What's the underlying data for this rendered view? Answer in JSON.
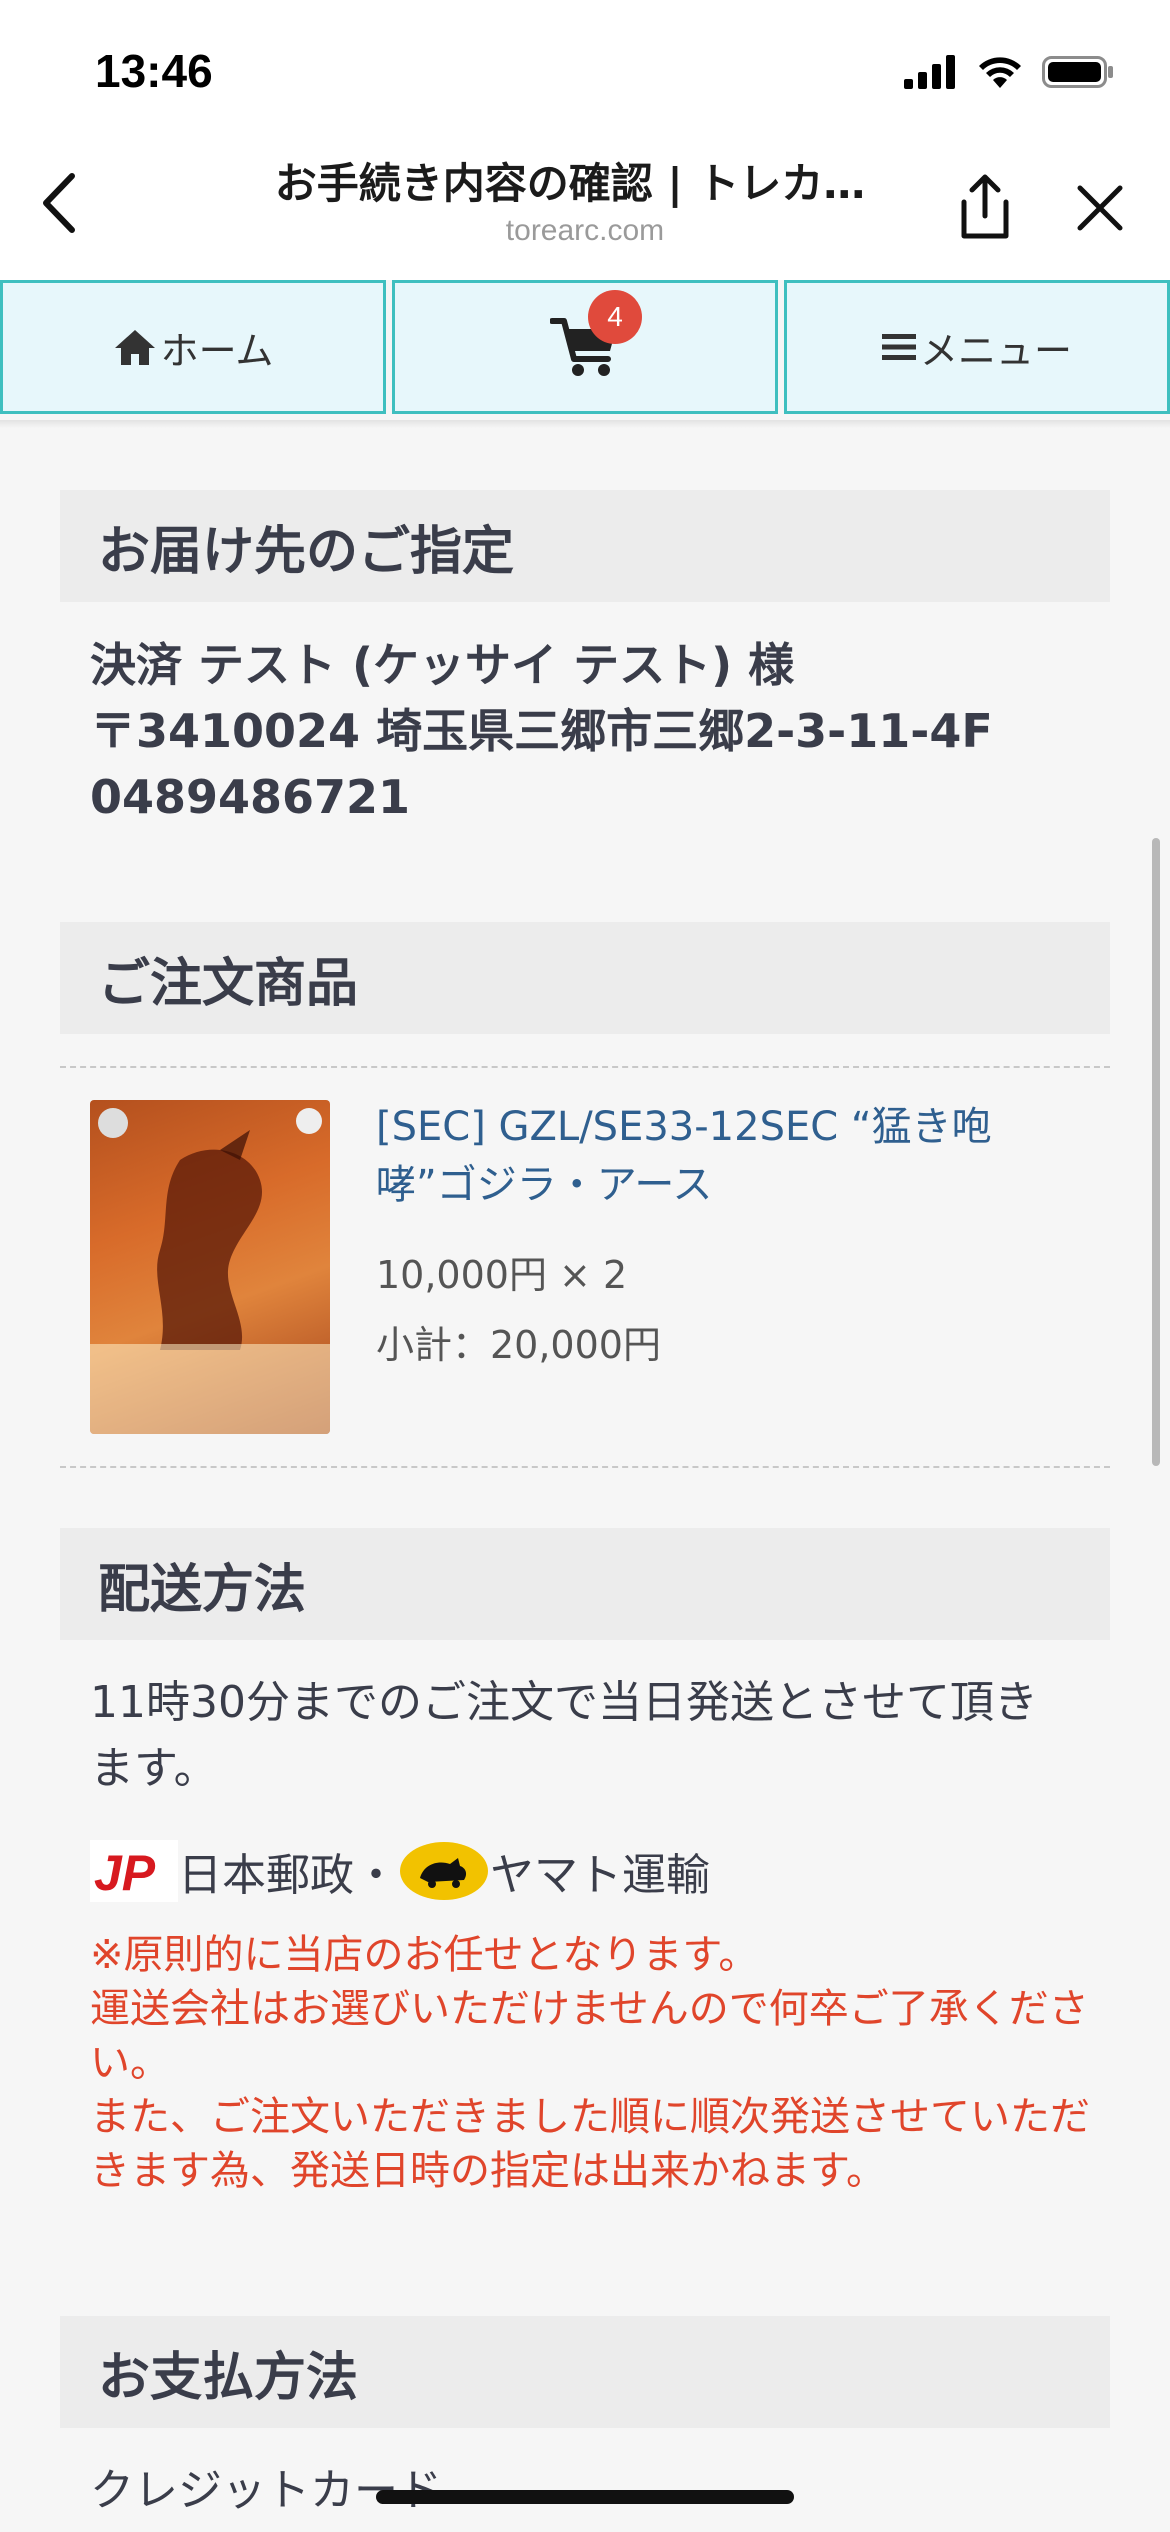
{
  "status_bar": {
    "time": "13:46"
  },
  "browser": {
    "title": "お手続き内容の確認 | トレカ…",
    "url": "torearc.com"
  },
  "tabs": {
    "home_label": "ホーム",
    "cart_badge": "4",
    "menu_label": "メニュー"
  },
  "shipping_address": {
    "heading": "お届け先のご指定",
    "name": "決済 テスト (ケッサイ テスト) 様",
    "address": "〒3410024 埼玉県三郷市三郷2-3-11-4F",
    "phone": "0489486721"
  },
  "order_items": {
    "heading": "ご注文商品",
    "items": [
      {
        "name": "[SEC] GZL/SE33-12SEC “猛き咆哮”ゴジラ・アース",
        "price_qty": "10,000円 × 2",
        "subtotal": "小計：20,000円"
      }
    ]
  },
  "delivery": {
    "heading": "配送方法",
    "description": "11時30分までのご注文で当日発送とさせて頂きます。",
    "carriers_label": "日本郵政・",
    "carriers_label_2": "ヤマト運輸",
    "note_1": "※原則的に当店のお任せとなります。",
    "note_2": "運送会社はお選びいただけませんので何卒ご了承ください。",
    "note_3": "また、ご注文いただきました順に順次発送させていただきます為、発送日時の指定は出来かねます。"
  },
  "payment": {
    "heading": "お支払方法",
    "method": "クレジットカード"
  },
  "colors": {
    "tab_bg": "#e7f7fb",
    "tab_border": "#3fbfbf",
    "badge": "#e04a3c",
    "link": "#2f5f8f",
    "notice": "#e0452b"
  }
}
